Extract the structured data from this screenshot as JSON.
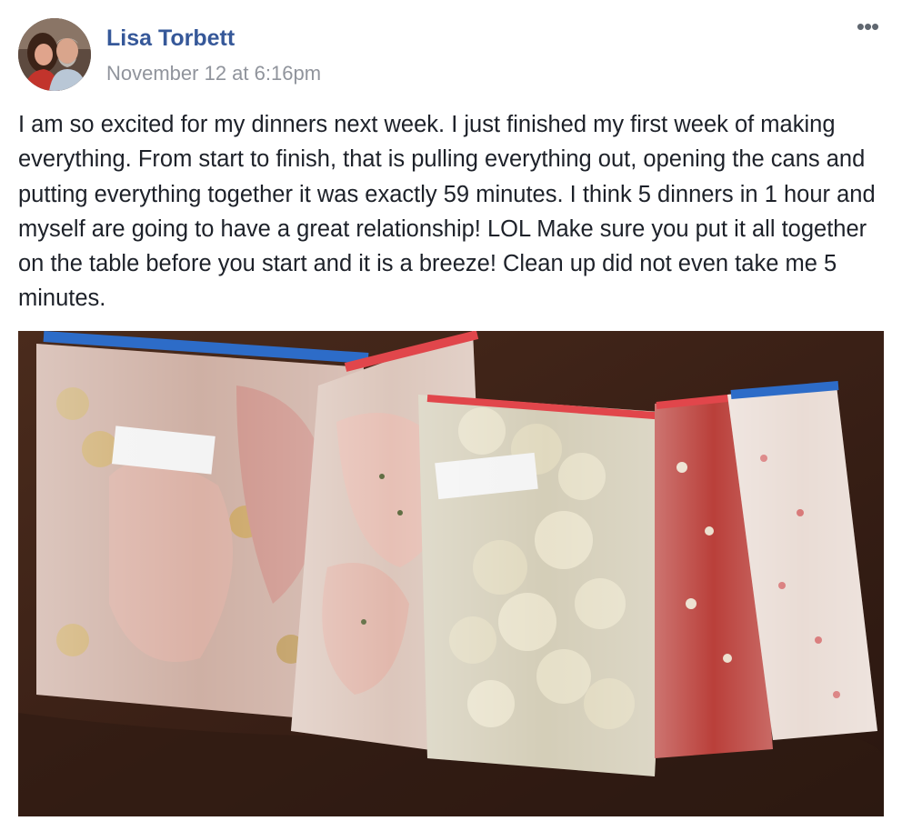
{
  "post": {
    "author": "Lisa Torbett",
    "timestamp": "November 12 at 6:16pm",
    "more_icon": "more-options-icon",
    "more_label": "•••",
    "text": "I am so excited for my dinners next week. I just finished my first week of making everything. From start to finish, that is pulling everything out, opening the cans and putting everything together it was exactly 59 minutes. I think 5 dinners in 1 hour and myself are going to have a great relationship! LOL Make sure you put it all together on the table before you start and it is a breeze! Clean up did not even take me 5 minutes."
  },
  "colors": {
    "author_link": "#365899",
    "timestamp": "#90949c",
    "text": "#1d2129",
    "table_wood": "#3a2218"
  }
}
